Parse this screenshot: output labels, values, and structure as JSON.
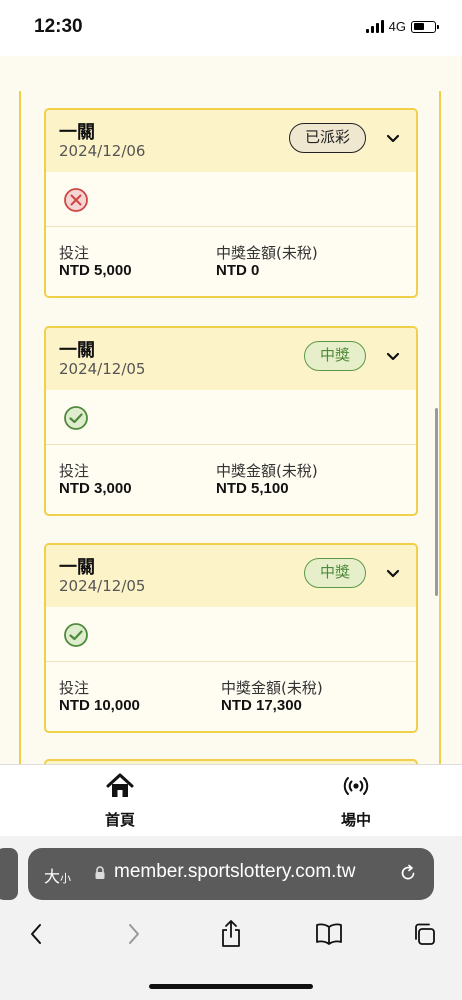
{
  "status_bar": {
    "time": "12:30",
    "network": "4G"
  },
  "bets": [
    {
      "title": "一關",
      "date": "2024/12/06",
      "status": "已派彩",
      "result": "lost",
      "stake_label": "投注",
      "stake": "NTD 5,000",
      "prize_label": "中獎金額(未稅)",
      "prize": "NTD 0"
    },
    {
      "title": "一關",
      "date": "2024/12/05",
      "status": "中獎",
      "result": "won",
      "stake_label": "投注",
      "stake": "NTD 3,000",
      "prize_label": "中獎金額(未稅)",
      "prize": "NTD 5,100"
    },
    {
      "title": "一關",
      "date": "2024/12/05",
      "status": "中獎",
      "result": "won",
      "stake_label": "投注",
      "stake": "NTD 10,000",
      "prize_label": "中獎金額(未稅)",
      "prize": "NTD 17,300"
    }
  ],
  "tabbar": {
    "home": {
      "label": "首頁",
      "icon": "home-icon"
    },
    "live": {
      "label": "場中",
      "icon": "broadcast-icon"
    }
  },
  "browser": {
    "text_size_label": "大",
    "text_size_small": "小",
    "url": "member.sportslottery.com.tw"
  },
  "colors": {
    "accent": "#f0cf49",
    "won": "#5c9a49",
    "lost": "#d64545"
  }
}
